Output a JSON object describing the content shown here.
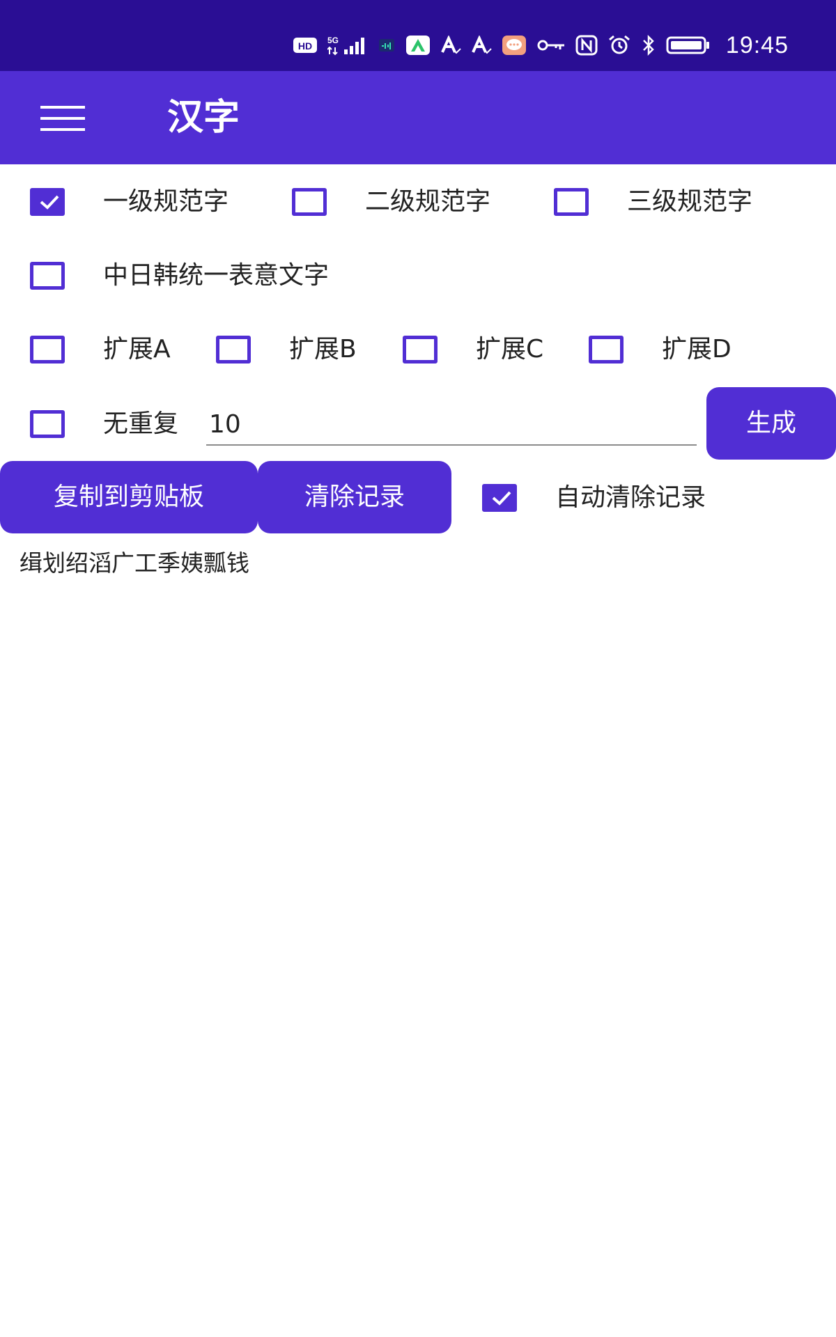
{
  "status_bar": {
    "time": "19:45",
    "hd_label": "HD",
    "network_label": "5G",
    "icons": [
      "hd-icon",
      "signal-icon",
      "wifi-icon",
      "app-store-icon",
      "font-icon",
      "font-icon",
      "message-icon",
      "key-icon",
      "nfc-icon",
      "alarm-icon",
      "bluetooth-icon",
      "battery-icon"
    ]
  },
  "app_bar": {
    "title": "汉字",
    "menu_icon": "hamburger-menu-icon"
  },
  "options": {
    "level1": {
      "label": "一级规范字",
      "checked": true
    },
    "level2": {
      "label": "二级规范字",
      "checked": false
    },
    "level3": {
      "label": "三级规范字",
      "checked": false
    },
    "cjk": {
      "label": "中日韩统一表意文字",
      "checked": false
    },
    "ext_a": {
      "label": "扩展A",
      "checked": false
    },
    "ext_b": {
      "label": "扩展B",
      "checked": false
    },
    "ext_c": {
      "label": "扩展C",
      "checked": false
    },
    "ext_d": {
      "label": "扩展D",
      "checked": false
    },
    "no_repeat": {
      "label": "无重复",
      "checked": false
    },
    "auto_clear": {
      "label": "自动清除记录",
      "checked": true
    }
  },
  "count_input": {
    "value": "10"
  },
  "buttons": {
    "generate": "生成",
    "copy": "复制到剪贴板",
    "clear": "清除记录"
  },
  "output": {
    "text": "缉划绍滔广工季姨瓢钱"
  },
  "colors": {
    "status_bar": "#2a0e94",
    "primary": "#512ed4",
    "text": "#222222"
  }
}
